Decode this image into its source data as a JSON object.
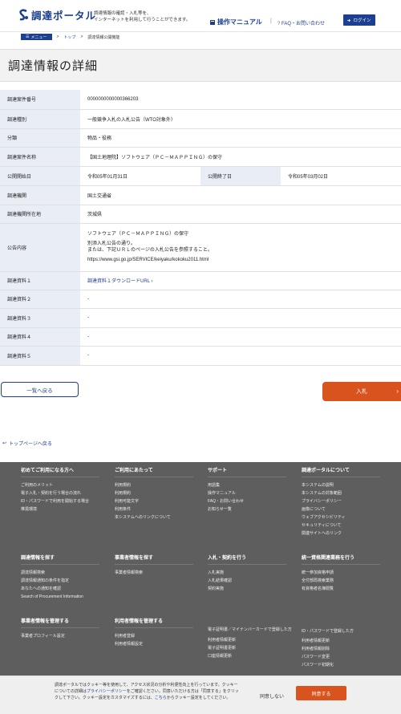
{
  "header": {
    "logo_text": "調達ポータル",
    "tagline_1": "調達情報の確認・入札等を、",
    "tagline_2": "インターネットを利用して行うことができます。",
    "manual": "操作マニュアル",
    "sep": "|",
    "faq": "FAQ・お問い合わせ",
    "login": "ログイン"
  },
  "breadcrumb": {
    "menu": "メニュー",
    "top": "トップ",
    "sep": ">",
    "current": "調達情報公開機能"
  },
  "page_title": "調達情報の詳細",
  "rows": [
    {
      "label": "調達案件番号",
      "value": "0000000000000366203"
    },
    {
      "label": "調達種別",
      "value": "一般競争入札の入札公告（WTO対象外）"
    },
    {
      "label": "分類",
      "value": "物品・役務"
    },
    {
      "label": "調達案件名称",
      "value": "【国土地理院】ソフトウェア（ＰＣ－ＭＡＰＰＩＮＧ）の保守"
    },
    {
      "label": "公開開始日",
      "value": "令和05年01月31日",
      "label2": "公開終了日",
      "value2": "令和05年03月02日"
    },
    {
      "label": "調達機関",
      "value": "国土交通省"
    },
    {
      "label": "調達機関所在地",
      "value": "茨城県"
    },
    {
      "label": "公告内容",
      "line1": "ソフトウェア（ＰＣ－ＭＡＰＰＩＮＧ）の保守",
      "line2": "別添入札公告の通り。",
      "line3": "または、下記ＵＲＬのページの入札公告を参照すること。",
      "line4": "https://www.gsi.go.jp/SERVICE/keiyaku/kokoku2011.html"
    },
    {
      "label": "調達資料１",
      "value": "調達資料１ダウンロードURL"
    },
    {
      "label": "調達資料２",
      "value": "-"
    },
    {
      "label": "調達資料３",
      "value": "-"
    },
    {
      "label": "調達資料４",
      "value": "-"
    },
    {
      "label": "調達資料５",
      "value": "-"
    }
  ],
  "buttons": {
    "back": "一覧へ戻る",
    "bid": "入札"
  },
  "top_link": "トップページへ戻る",
  "footer": {
    "col1": {
      "h": "初めてご利用になる方へ",
      "items": [
        "ご利用のメリット",
        "電子入札・契約を行う場合の流れ",
        "ID・パスワードで利用を開始する場合",
        "推奨環境"
      ]
    },
    "col2": {
      "h": "ご利用にあたって",
      "items": [
        "利用規約",
        "利用規約",
        "利用可能文字",
        "利用条件",
        "本システムへのリンクについて"
      ]
    },
    "col3": {
      "h": "サポート",
      "items": [
        "用語集",
        "操作マニュアル",
        "FAQ・お問い合わせ",
        "お知らせ一覧"
      ]
    },
    "col4": {
      "h": "調達ポータルについて",
      "items": [
        "本システムの説明",
        "本システムの対象範囲",
        "プライバシーポリシー",
        "画像について",
        "ウェブアクセシビリティ",
        "セキュリティについて",
        "関連サイトへのリンク"
      ]
    },
    "col5": {
      "h": "調達情報を探す",
      "items": [
        "調達情報検索",
        "調達情報通知の条件を指定",
        "あなたへの通知を確認",
        "Search of Procurement Information"
      ]
    },
    "col6": {
      "h": "事業者情報を探す",
      "items": [
        "事業者情報検索"
      ]
    },
    "col7": {
      "h": "入札・契約を行う",
      "items": [
        "入札実施",
        "入札結果確認",
        "契約実施"
      ]
    },
    "col8": {
      "h": "統一資格関連業務を行う",
      "items": [
        "統一参加資格申請",
        "全付部局検索業務",
        "有資格者名簿閲覧"
      ]
    },
    "col9": {
      "h": "事業者情報を管理する",
      "items": [
        "事業者プロフィール設定"
      ]
    },
    "col10": {
      "h": "利用者情報を管理する",
      "items": [
        "利用者登録",
        "利用者情報設定"
      ]
    },
    "col11": {
      "h": "電子証明書／マイナンバーカードで登録した方",
      "items": [
        "利用者情報更新",
        "電子証明書更新",
        "口座情報更新"
      ]
    },
    "col12": {
      "h": "ID・パスワードで登録した方",
      "items": [
        "利用者情報更新",
        "利用者情報削除",
        "パスワード変更",
        "パスワード初期化"
      ]
    }
  },
  "cookie": {
    "t1": "調達ポータルではクッキー等を使用して、アクセス状況の分析や利便性向上を行っています。クッキーについての詳細は",
    "link1": "プライバシーポリシー",
    "t2": "をご確認ください。同意いただける方は「同意する」をクリックして下さい。クッキー設定をカスタマイズするには、",
    "link2": "こちら",
    "t3": "からクッキー設定をしてください。",
    "decline": "同意しない",
    "agree": "同意する"
  }
}
